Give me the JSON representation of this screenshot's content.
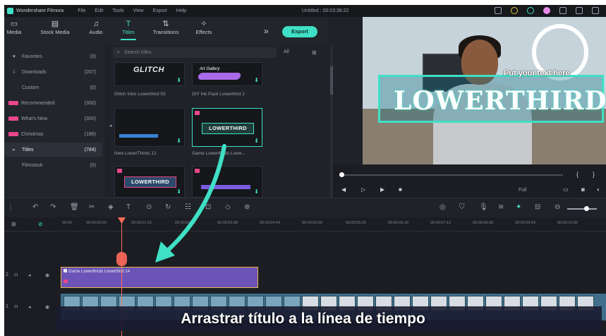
{
  "titlebar": {
    "app_name": "Wondershare Filmora",
    "menu": [
      "File",
      "Edit",
      "Tools",
      "View",
      "Export",
      "Help"
    ],
    "document": "Untitled : 00:03:38:22"
  },
  "tabs": [
    {
      "label": "Media",
      "icon": "folder-icon"
    },
    {
      "label": "Stock Media",
      "icon": "stock-media-icon"
    },
    {
      "label": "Audio",
      "icon": "music-note-icon"
    },
    {
      "label": "Titles",
      "icon": "text-icon"
    },
    {
      "label": "Transitions",
      "icon": "transitions-icon"
    },
    {
      "label": "Effects",
      "icon": "effects-icon"
    }
  ],
  "export_label": "Export",
  "sidebar": {
    "items": [
      {
        "label": "Favorites",
        "count": "(0)",
        "icon": "heart-icon"
      },
      {
        "label": "Downloads",
        "count": "(207)",
        "icon": "download-icon"
      },
      {
        "label": "Custom",
        "count": "(0)",
        "icon": ""
      },
      {
        "label": "Recommended",
        "count": "(300)",
        "icon": "badge-icon"
      },
      {
        "label": "What's New",
        "count": "(300)",
        "icon": "badge-icon"
      },
      {
        "label": "Christmas",
        "count": "(186)",
        "icon": "badge-icon"
      },
      {
        "label": "Titles",
        "count": "(784)",
        "icon": "caret-right-icon"
      },
      {
        "label": "Filmstock",
        "count": "(0)",
        "icon": ""
      }
    ]
  },
  "search": {
    "placeholder": "Search titles",
    "filter": "All"
  },
  "tiles": [
    {
      "label": "Glitch Intro Lowerthird 02",
      "art": "GLITCH"
    },
    {
      "label": "DIY Ink Pack Lowerthird 2",
      "art": "Art Gallery"
    },
    {
      "label": "New LowerThirds 12",
      "art": ""
    },
    {
      "label": "Game Lowerthirds Lowe...",
      "art": "LOWERTHIRD"
    },
    {
      "label": "",
      "art": "LOWERTHIRD"
    },
    {
      "label": "",
      "art": ""
    }
  ],
  "preview": {
    "lowerthird_main": "LOWERTHIRD",
    "lowerthird_sub": "Put your text here"
  },
  "playback": {
    "quality": "Full"
  },
  "ruler": [
    "00:00",
    "00:00:00:20",
    "00:00:01:16",
    "00:00:02:12",
    "00:00:03:08",
    "00:00:04:04",
    "00:00:05:00",
    "00:00:05:20",
    "00:00:06:16",
    "00:00:07:12",
    "00:00:08:08",
    "00:00:09:04",
    "00:00:10:00"
  ],
  "timeline": {
    "title_clip_label": "Game Lowerthirds Lowerthird 14"
  },
  "caption": "Arrastrar título a la línea de tiempo",
  "colors": {
    "accent": "#3fe0c5",
    "playhead": "#ff6b5b",
    "clip": "#6b53b8",
    "badge": "#e8478b"
  }
}
